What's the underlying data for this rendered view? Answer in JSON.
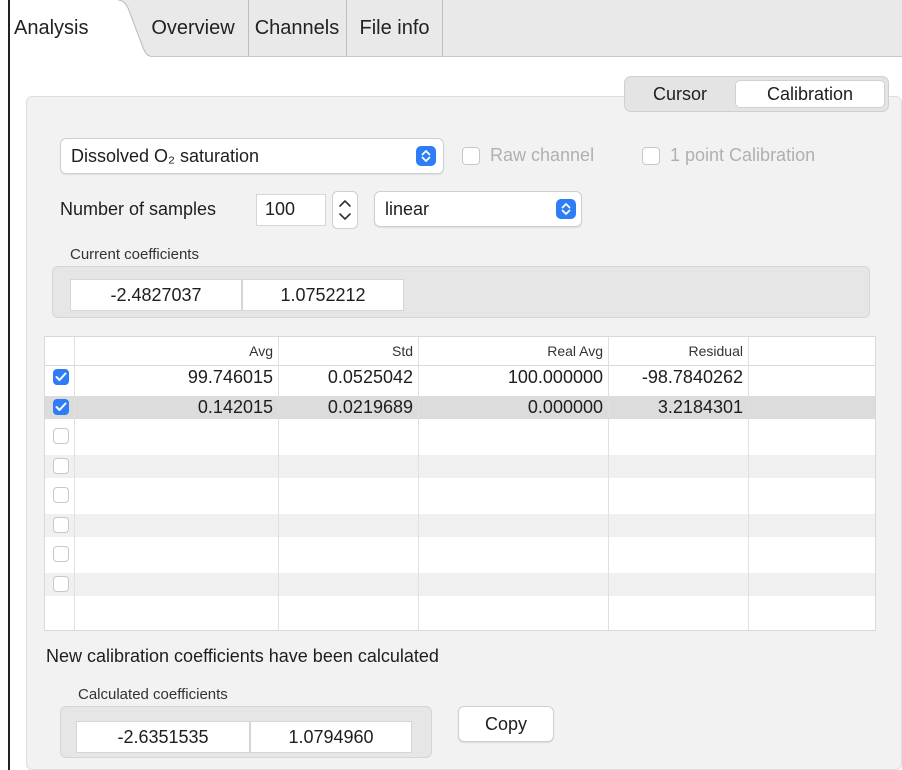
{
  "tabs": [
    "Analysis",
    "Overview",
    "Channels",
    "File info"
  ],
  "subtabs": [
    "Cursor",
    "Calibration"
  ],
  "channel_select": {
    "value": "Dissolved O₂ saturation",
    "icon": "chevron-up-down-icon"
  },
  "raw_channel": {
    "label": "Raw channel",
    "checked": false,
    "enabled": false
  },
  "one_point": {
    "label": "1 point Calibration",
    "checked": false,
    "enabled": false
  },
  "samples": {
    "label": "Number of samples",
    "value": "100"
  },
  "mode_select": {
    "value": "linear"
  },
  "current": {
    "caption": "Current coefficients",
    "values": [
      "-2.4827037",
      "1.0752212"
    ]
  },
  "table": {
    "headers": [
      "",
      "Avg",
      "Std",
      "Real Avg",
      "Residual",
      ""
    ],
    "rows": [
      {
        "checked": true,
        "avg": "99.746015",
        "std": "0.0525042",
        "real": "100.000000",
        "residual": "-98.7840262"
      },
      {
        "checked": true,
        "avg": "0.142015",
        "std": "0.0219689",
        "real": "0.000000",
        "residual": "3.2184301"
      },
      {
        "checked": false,
        "avg": "",
        "std": "",
        "real": "",
        "residual": ""
      },
      {
        "checked": false,
        "avg": "",
        "std": "",
        "real": "",
        "residual": ""
      },
      {
        "checked": false,
        "avg": "",
        "std": "",
        "real": "",
        "residual": ""
      },
      {
        "checked": false,
        "avg": "",
        "std": "",
        "real": "",
        "residual": ""
      },
      {
        "checked": false,
        "avg": "",
        "std": "",
        "real": "",
        "residual": ""
      },
      {
        "checked": false,
        "avg": "",
        "std": "",
        "real": "",
        "residual": ""
      }
    ]
  },
  "status": "New calibration coefficients have been calculated",
  "calculated": {
    "caption": "Calculated coefficients",
    "values": [
      "-2.6351535",
      "1.0794960"
    ]
  },
  "copy_label": "Copy",
  "colors": {
    "accent": "#2f7df6",
    "panel": "#f2f2f2",
    "selected_row": "#dcdcdc"
  }
}
